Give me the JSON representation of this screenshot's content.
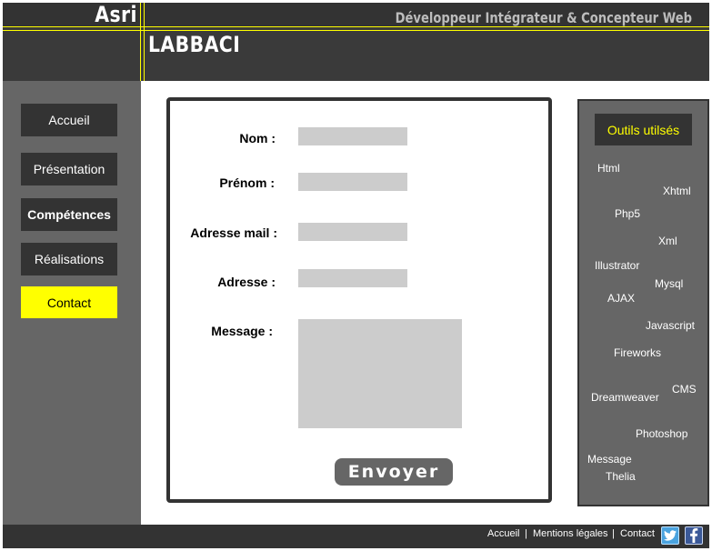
{
  "header": {
    "first_name": "Asri",
    "last_name": "LABBACI",
    "tagline": "Développeur Intégrateur & Concepteur Web"
  },
  "nav": {
    "items": [
      {
        "label": "Accueil"
      },
      {
        "label": "Présentation"
      },
      {
        "label": "Compétences"
      },
      {
        "label": "Réalisations"
      },
      {
        "label": "Contact"
      }
    ],
    "active": "Contact"
  },
  "form": {
    "labels": {
      "nom": "Nom :",
      "prenom": "Prénom :",
      "email": "Adresse mail :",
      "adresse": "Adresse :",
      "message": "Message :"
    },
    "values": {
      "nom": "",
      "prenom": "",
      "email": "",
      "adresse": "",
      "message": ""
    },
    "submit_label": "Envoyer"
  },
  "tools": {
    "title": "Outils utilsés",
    "items": [
      "Html",
      "Xhtml",
      "Php5",
      "Xml",
      "Illustrator",
      "Mysql",
      "AJAX",
      "Javascript",
      "Fireworks",
      "CMS",
      "Dreamweaver",
      "Photoshop",
      "Message",
      "Thelia"
    ]
  },
  "footer": {
    "links": [
      "Accueil",
      "Mentions légales",
      "Contact"
    ],
    "separator": "|"
  },
  "colors": {
    "accent": "#ffff00",
    "dark": "#333333",
    "mid": "#666666",
    "field": "#cccccc"
  },
  "social": {
    "twitter_icon": "twitter-icon",
    "facebook_icon": "facebook-icon"
  }
}
